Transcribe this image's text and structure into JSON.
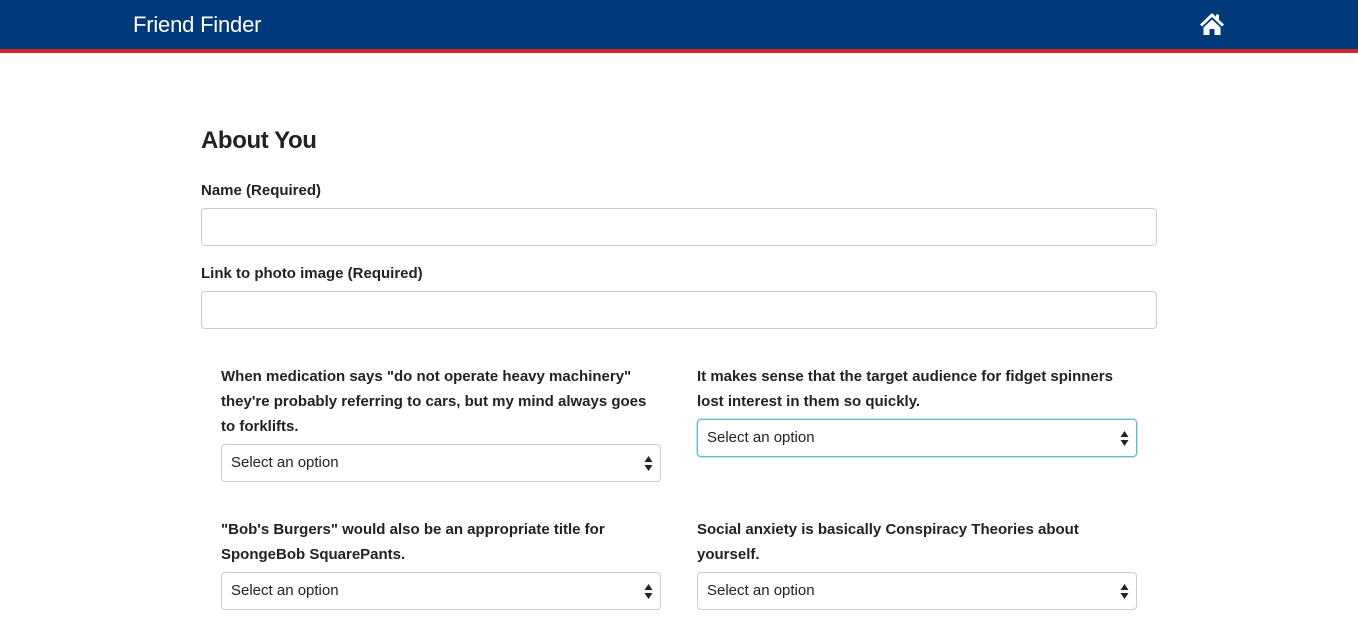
{
  "navbar": {
    "brand": "Friend Finder",
    "home_icon": "home-icon",
    "background_color": "#003a7a",
    "accent_color": "#d0262a"
  },
  "form": {
    "section_title": "About You",
    "name_label": "Name (Required)",
    "name_value": "",
    "photo_label": "Link to photo image (Required)",
    "photo_value": "",
    "questions": [
      {
        "text": "When medication says \"do not operate heavy machinery\" they're probably referring to cars, but my mind always goes to forklifts.",
        "selected": "Select an option"
      },
      {
        "text": "It makes sense that the target audience for fidget spinners lost interest in them so quickly.",
        "selected": "Select an option"
      },
      {
        "text": "\"Bob's Burgers\" would also be an appropriate title for SpongeBob SquarePants.",
        "selected": "Select an option"
      },
      {
        "text": "Social anxiety is basically Conspiracy Theories about yourself.",
        "selected": "Select an option"
      }
    ]
  }
}
